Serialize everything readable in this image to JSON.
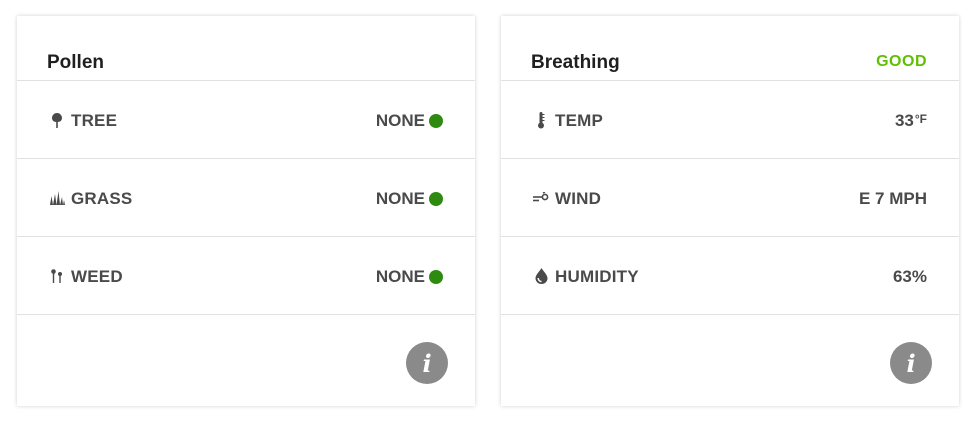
{
  "colors": {
    "good": "#5fbf00",
    "dot_none": "#2e8b10",
    "info_bg": "#8a8a8a",
    "text": "#4a4a4a",
    "title": "#1f1f1f"
  },
  "pollen": {
    "title": "Pollen",
    "rows": [
      {
        "icon": "tree-icon",
        "label": "TREE",
        "value": "NONE"
      },
      {
        "icon": "grass-icon",
        "label": "GRASS",
        "value": "NONE"
      },
      {
        "icon": "weed-icon",
        "label": "WEED",
        "value": "NONE"
      }
    ],
    "info_label": "i"
  },
  "breathing": {
    "title": "Breathing",
    "status": "GOOD",
    "rows": [
      {
        "icon": "thermometer-icon",
        "label": "TEMP",
        "value": "33",
        "unit": "°F"
      },
      {
        "icon": "wind-icon",
        "label": "WIND",
        "value": "E 7 MPH"
      },
      {
        "icon": "droplet-icon",
        "label": "HUMIDITY",
        "value": "63%"
      }
    ],
    "info_label": "i"
  }
}
